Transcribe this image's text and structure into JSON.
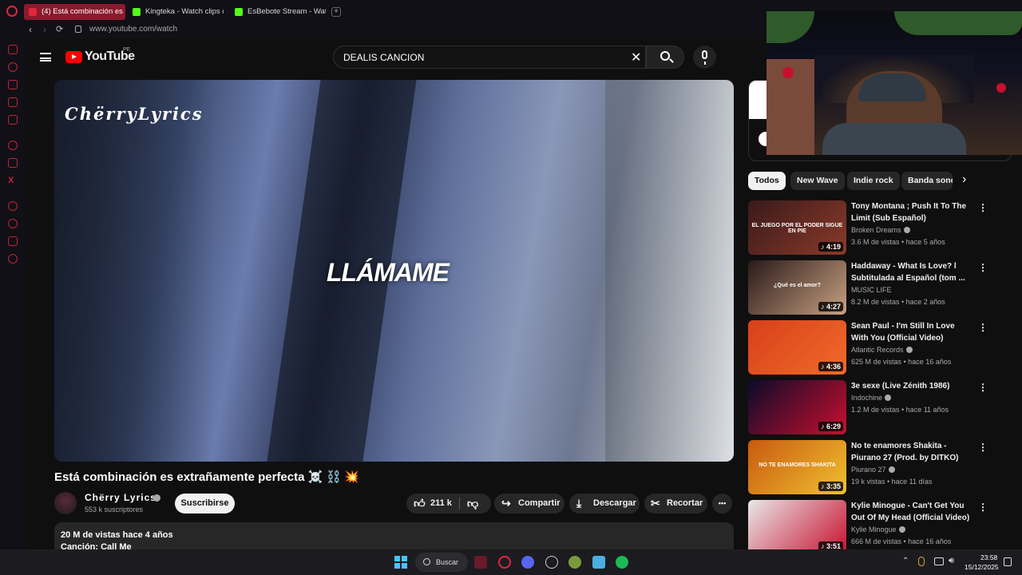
{
  "browser": {
    "tabs": [
      {
        "label": "(4) Está combinación es",
        "color": "#e0263a"
      },
      {
        "label": "Kingteka - Watch clips on",
        "color": "#53fc18"
      },
      {
        "label": "EsBebote Stream - Watch",
        "color": "#53fc18"
      }
    ],
    "new_tab": "+",
    "url": "www.youtube.com/watch",
    "back": "‹",
    "forward": "›",
    "reload": "⟳"
  },
  "youtube": {
    "logo_text": "YouTube",
    "country": "PE",
    "search_value": "DEALIS CANCION",
    "search_clear": "✕"
  },
  "video": {
    "watermark": "ChërryLyrics",
    "lyric": "LLÁMAME",
    "title": "Está combinación es extrañamente perfecta ☠️ ⛓️ 💥",
    "channel": "Chërry Lyrics",
    "subscribers": "553 k suscriptores",
    "subscribe_label": "Suscribirse",
    "likes": "211 k",
    "share_label": "Compartir",
    "download_label": "Descargar",
    "clip_label": "Recortar",
    "more_label": "•••",
    "views_line": "20 M de vistas  hace 4 años",
    "song_line": "Canción: Call Me"
  },
  "chips": [
    {
      "label": "Todos",
      "selected": true
    },
    {
      "label": "New Wave",
      "selected": false
    },
    {
      "label": "Indie rock",
      "selected": false
    },
    {
      "label": "Banda sonora",
      "selected": false
    }
  ],
  "chip_next": "›",
  "recommendations": [
    {
      "title": "Tony Montana ; Push It To The Limit (Sub Español)",
      "channel": "Broken Dreams",
      "verified": true,
      "meta": "3.6 M de vistas • hace 5 años",
      "duration": "♪ 4:19",
      "thumb_caption": "EL JUEGO POR EL PODER SIGUE EN PIE",
      "colors": [
        "#3a1a1a",
        "#8a3a2a"
      ]
    },
    {
      "title": "Haddaway - What Is Love? l Subtitulada al Español (tom ...",
      "channel": "MUSIC LIFE",
      "verified": false,
      "meta": "8.2 M de vistas • hace 2 años",
      "duration": "♪ 4:27",
      "thumb_caption": "¿Qué es el amor?",
      "colors": [
        "#2a1a1a",
        "#c8a080"
      ]
    },
    {
      "title": "Sean Paul - I'm Still In Love With You (Official Video)",
      "channel": "Atlantic Records",
      "verified": true,
      "meta": "625 M de vistas • hace 16 años",
      "duration": "♪ 4:36",
      "thumb_caption": "",
      "colors": [
        "#d8401a",
        "#f06a2a"
      ]
    },
    {
      "title": "3e sexe (Live Zénith 1986)",
      "channel": "Indochine",
      "verified": true,
      "meta": "1.2 M de vistas • hace 11 años",
      "duration": "♪ 6:29",
      "thumb_caption": "",
      "colors": [
        "#0a0a2a",
        "#c8102e"
      ]
    },
    {
      "title": "No te enamores Shakita - Piurano 27 (Prod. by DITKO)",
      "channel": "Piurano 27",
      "verified": true,
      "meta": "19 k vistas • hace 11 días",
      "duration": "♪ 3:35",
      "thumb_caption": "NO TE ENAMORES SHAKITA",
      "colors": [
        "#c85a10",
        "#f0c030"
      ]
    },
    {
      "title": "Kylie Minogue - Can't Get You Out Of My Head (Official Video)",
      "channel": "Kylie Minogue",
      "verified": true,
      "meta": "666 M de vistas • hace 16 años",
      "duration": "♪ 3:51",
      "thumb_caption": "",
      "colors": [
        "#e8e8e8",
        "#c8102e"
      ]
    }
  ],
  "taskbar": {
    "search_label": "Buscar",
    "time": "23:58",
    "date": "15/12/2025"
  },
  "colors": {
    "yt_red": "#ff0000",
    "opera_red": "#e0263a",
    "background": "#0f0f0f"
  }
}
